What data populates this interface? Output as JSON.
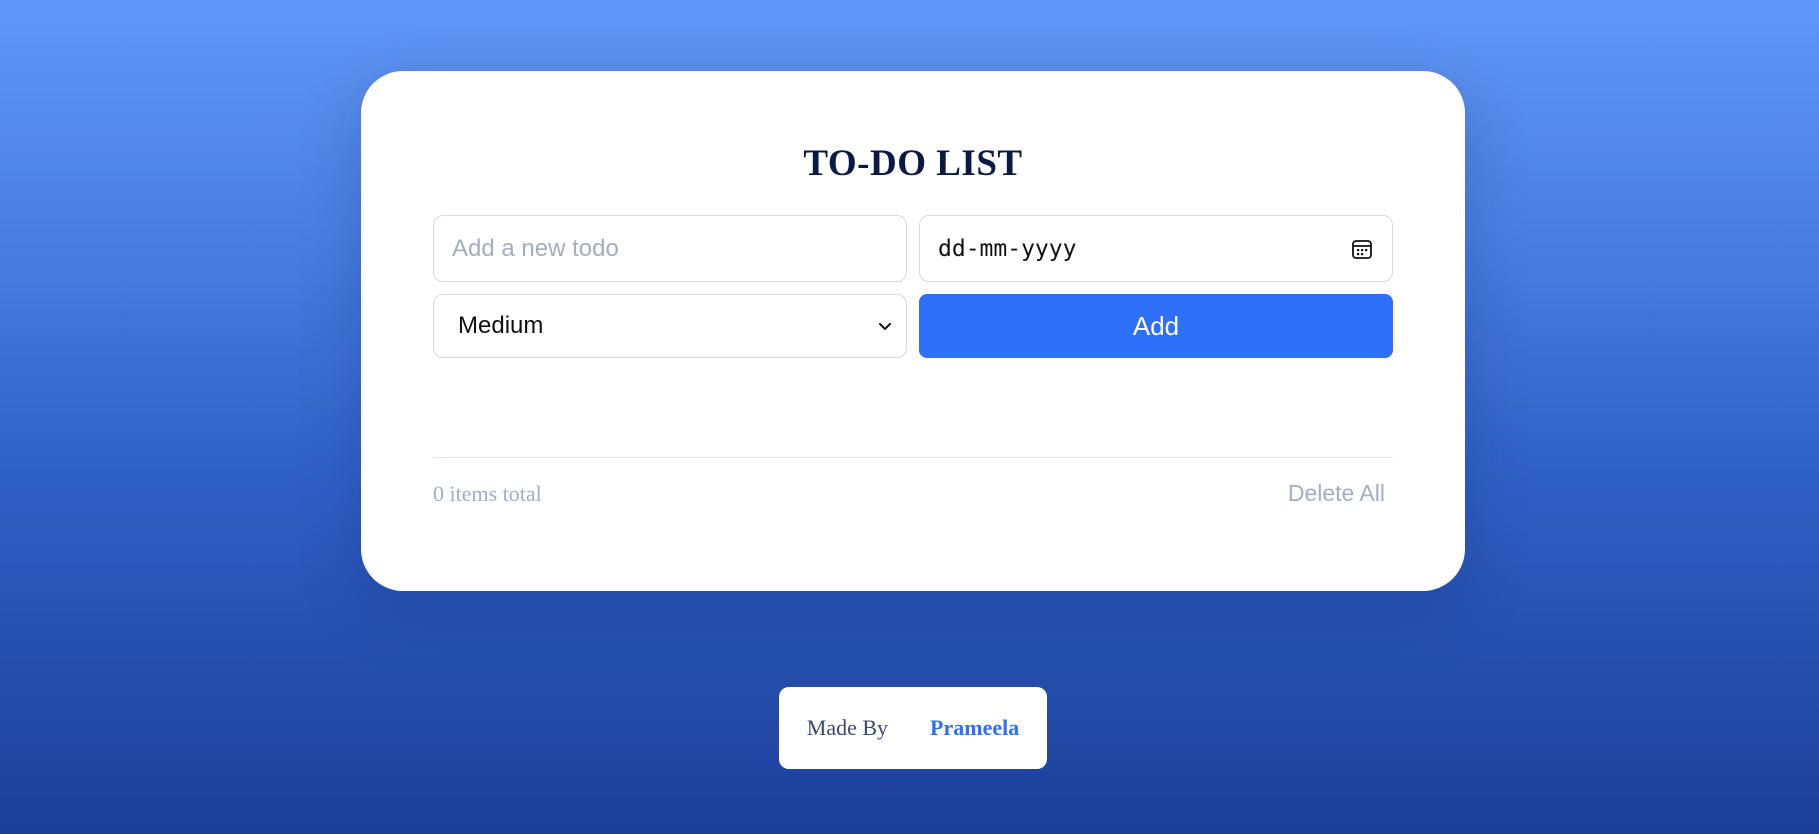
{
  "app": {
    "title": "TO-DO LIST"
  },
  "form": {
    "todo_placeholder": "Add a new todo",
    "todo_value": "",
    "date_placeholder": "dd-mm-yyyy",
    "priority_selected": "Medium",
    "add_label": "Add"
  },
  "summary": {
    "items_total": "0 items total",
    "delete_all_label": "Delete All"
  },
  "footer": {
    "made_by_label": "Made By",
    "author": "Prameela"
  },
  "icons": {
    "date": "calendar-icon",
    "select": "chevron-down-icon"
  },
  "colors": {
    "accent": "#2f70fa",
    "title": "#0b1a44",
    "muted": "#a3aec2",
    "background_top": "#6197f6",
    "background_bottom": "#1c3f98"
  }
}
